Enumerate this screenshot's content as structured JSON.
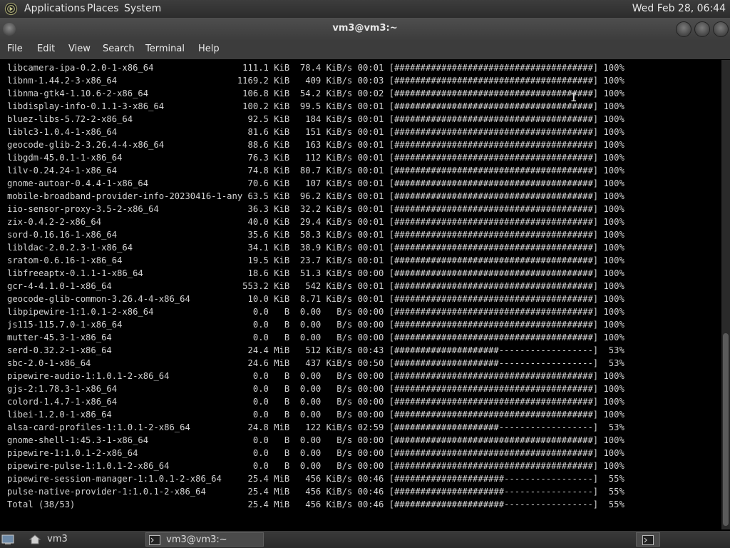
{
  "top_panel": {
    "menus": [
      "Applications",
      "Places",
      "System"
    ],
    "clock": "Wed Feb 28, 06:44"
  },
  "window": {
    "title": "vm3@vm3:~",
    "menu": [
      "File",
      "Edit",
      "View",
      "Search",
      "Terminal",
      "Help"
    ]
  },
  "terminal": {
    "lines": [
      "libcamera-ipa-0.2.0-1-x86_64                 111.1 KiB  78.4 KiB/s 00:01 [######################################] 100%",
      "libnm-1.44.2-3-x86_64                       1169.2 KiB   409 KiB/s 00:03 [######################################] 100%",
      "libnma-gtk4-1.10.6-2-x86_64                  106.8 KiB  54.2 KiB/s 00:02 [######################################] 100%",
      "libdisplay-info-0.1.1-3-x86_64               100.2 KiB  99.5 KiB/s 00:01 [######################################] 100%",
      "bluez-libs-5.72-2-x86_64                      92.5 KiB   184 KiB/s 00:01 [######################################] 100%",
      "liblc3-1.0.4-1-x86_64                         81.6 KiB   151 KiB/s 00:01 [######################################] 100%",
      "geocode-glib-2-3.26.4-4-x86_64                88.6 KiB   163 KiB/s 00:01 [######################################] 100%",
      "libgdm-45.0.1-1-x86_64                        76.3 KiB   112 KiB/s 00:01 [######################################] 100%",
      "lilv-0.24.24-1-x86_64                         74.8 KiB  80.7 KiB/s 00:01 [######################################] 100%",
      "gnome-autoar-0.4.4-1-x86_64                   70.6 KiB   107 KiB/s 00:01 [######################################] 100%",
      "mobile-broadband-provider-info-20230416-1-any 63.5 KiB  96.2 KiB/s 00:01 [######################################] 100%",
      "iio-sensor-proxy-3.5-2-x86_64                 36.3 KiB  32.2 KiB/s 00:01 [######################################] 100%",
      "zix-0.4.2-2-x86_64                            40.0 KiB  29.4 KiB/s 00:01 [######################################] 100%",
      "sord-0.16.16-1-x86_64                         35.6 KiB  58.3 KiB/s 00:01 [######################################] 100%",
      "libldac-2.0.2.3-1-x86_64                      34.1 KiB  38.9 KiB/s 00:01 [######################################] 100%",
      "sratom-0.6.16-1-x86_64                        19.5 KiB  23.7 KiB/s 00:01 [######################################] 100%",
      "libfreeaptx-0.1.1-1-x86_64                    18.6 KiB  51.3 KiB/s 00:00 [######################################] 100%",
      "gcr-4-4.1.0-1-x86_64                         553.2 KiB   542 KiB/s 00:01 [######################################] 100%",
      "geocode-glib-common-3.26.4-4-x86_64           10.0 KiB  8.71 KiB/s 00:01 [######################################] 100%",
      "libpipewire-1:1.0.1-2-x86_64                   0.0   B  0.00   B/s 00:00 [######################################] 100%",
      "js115-115.7.0-1-x86_64                         0.0   B  0.00   B/s 00:00 [######################################] 100%",
      "mutter-45.3-1-x86_64                           0.0   B  0.00   B/s 00:00 [######################################] 100%",
      "serd-0.32.2-1-x86_64                          24.4 MiB   512 KiB/s 00:43 [####################------------------]  53%",
      "sbc-2.0-1-x86_64                              24.6 MiB   437 KiB/s 00:50 [####################------------------]  53%",
      "pipewire-audio-1:1.0.1-2-x86_64                0.0   B  0.00   B/s 00:00 [######################################] 100%",
      "gjs-2:1.78.3-1-x86_64                          0.0   B  0.00   B/s 00:00 [######################################] 100%",
      "colord-1.4.7-1-x86_64                          0.0   B  0.00   B/s 00:00 [######################################] 100%",
      "libei-1.2.0-1-x86_64                           0.0   B  0.00   B/s 00:00 [######################################] 100%",
      "alsa-card-profiles-1:1.0.1-2-x86_64           24.8 MiB   122 KiB/s 02:59 [####################------------------]  53%",
      "gnome-shell-1:45.3-1-x86_64                    0.0   B  0.00   B/s 00:00 [######################################] 100%",
      "pipewire-1:1.0.1-2-x86_64                      0.0   B  0.00   B/s 00:00 [######################################] 100%",
      "pipewire-pulse-1:1.0.1-2-x86_64                0.0   B  0.00   B/s 00:00 [######################################] 100%",
      "pipewire-session-manager-1:1.0.1-2-x86_64     25.4 MiB   456 KiB/s 00:46 [#####################-----------------]  55%",
      "pulse-native-provider-1:1.0.1-2-x86_64        25.4 MiB   456 KiB/s 00:46 [#####################-----------------]  55%",
      "Total (38/53)                                 25.4 MiB   456 KiB/s 00:46 [#####################-----------------]  55%"
    ]
  },
  "bottom_panel": {
    "workspace_label": "vm3",
    "task_label": "vm3@vm3:~"
  },
  "icons": {
    "distro_logo": "foresight-logo-icon",
    "window_menu": "window-menu-icon",
    "show_desktop": "show-desktop-icon",
    "home": "home-folder-icon",
    "terminal": "terminal-icon"
  },
  "colors": {
    "panel": "#2f2f2f",
    "terminal_bg": "#000000",
    "terminal_fg": "#d3d3d3"
  }
}
